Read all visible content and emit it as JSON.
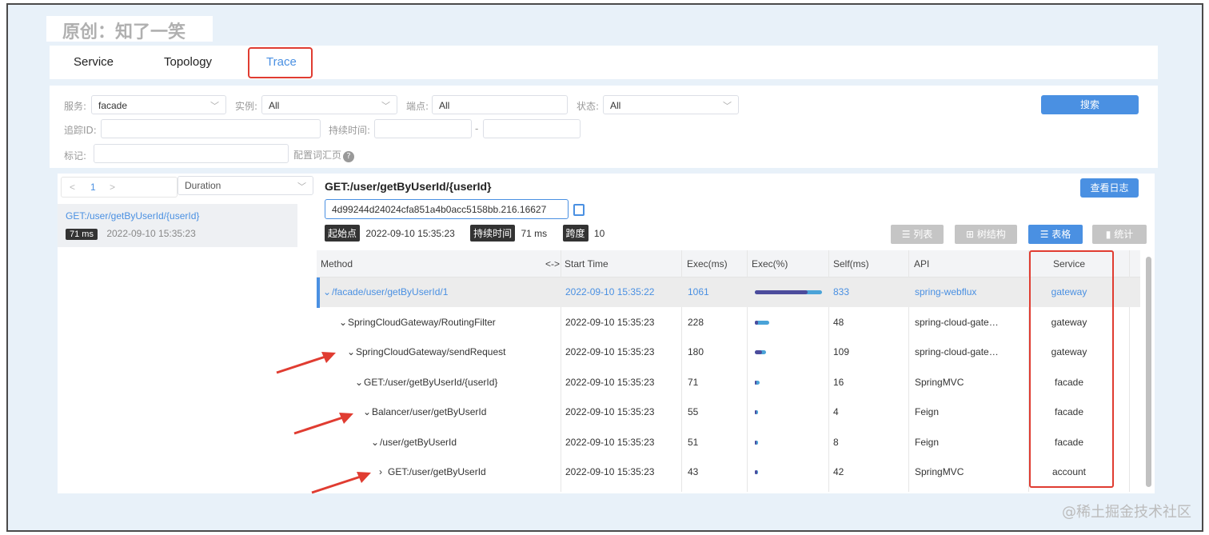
{
  "banner": {
    "text": "原创：知了一笑"
  },
  "tabs": [
    {
      "label": "Service"
    },
    {
      "label": "Topology"
    },
    {
      "label": "Trace"
    }
  ],
  "filters": {
    "service_label": "服务:",
    "service_value": "facade",
    "instance_label": "实例:",
    "instance_value": "All",
    "endpoint_label": "端点:",
    "endpoint_value": "All",
    "status_label": "状态:",
    "status_value": "All",
    "search_label": "搜索",
    "traceid_label": "追踪ID:",
    "traceid_value": "",
    "duration_label": "持续时间:",
    "duration_sep": "-",
    "tag_label": "标记:",
    "tag_value": "",
    "config_label": "配置词汇页"
  },
  "left": {
    "page": "1",
    "prev": "<",
    "next": ">",
    "sort_value": "Duration",
    "trace": {
      "endpoint": "GET:/user/getByUserId/{userId}",
      "duration": "71 ms",
      "time": "2022-09-10 15:35:23"
    }
  },
  "detail": {
    "title": "GET:/user/getByUserId/{userId}",
    "log_button": "查看日志",
    "trace_id": "4d99244d24024cfa851a4b0acc5158bb.216.16627",
    "start_label": "起始点",
    "start_value": "2022-09-10 15:35:23",
    "duration_label": "持续时间",
    "duration_value": "71 ms",
    "span_label": "跨度",
    "span_value": "10",
    "views": [
      "列表",
      "树结构",
      "表格",
      "统计"
    ],
    "active_view": "表格"
  },
  "table": {
    "headers": [
      "Method",
      "<->",
      "Start Time",
      "Exec(ms)",
      "Exec(%)",
      "Self(ms)",
      "API",
      "Service"
    ],
    "rows": [
      {
        "method": "/facade/user/getByUserId/1",
        "toggle": "⌄",
        "start": "2022-09-10 15:35:22",
        "exec": "1061",
        "exec_pct": 1.0,
        "self": "833",
        "self_pct": 0.785,
        "api": "spring-webflux",
        "service": "gateway"
      },
      {
        "method": "SpringCloudGateway/RoutingFilter",
        "toggle": "⌄",
        "start": "2022-09-10 15:35:23",
        "exec": "228",
        "exec_pct": 0.215,
        "self": "48",
        "self_pct": 0.045,
        "api": "spring-cloud-gate…",
        "service": "gateway"
      },
      {
        "method": "SpringCloudGateway/sendRequest",
        "toggle": "⌄",
        "start": "2022-09-10 15:35:23",
        "exec": "180",
        "exec_pct": 0.17,
        "self": "109",
        "self_pct": 0.103,
        "api": "spring-cloud-gate…",
        "service": "gateway"
      },
      {
        "method": "GET:/user/getByUserId/{userId}",
        "toggle": "⌄",
        "start": "2022-09-10 15:35:23",
        "exec": "71",
        "exec_pct": 0.067,
        "self": "16",
        "self_pct": 0.015,
        "api": "SpringMVC",
        "service": "facade"
      },
      {
        "method": "Balancer/user/getByUserId",
        "toggle": "⌄",
        "start": "2022-09-10 15:35:23",
        "exec": "55",
        "exec_pct": 0.052,
        "self": "4",
        "self_pct": 0.004,
        "api": "Feign",
        "service": "facade"
      },
      {
        "method": "/user/getByUserId",
        "toggle": "⌄",
        "start": "2022-09-10 15:35:23",
        "exec": "51",
        "exec_pct": 0.048,
        "self": "8",
        "self_pct": 0.008,
        "api": "Feign",
        "service": "facade"
      },
      {
        "method": "GET:/user/getByUserId",
        "toggle": "›",
        "start": "2022-09-10 15:35:23",
        "exec": "43",
        "exec_pct": 0.041,
        "self": "42",
        "self_pct": 0.04,
        "api": "SpringMVC",
        "service": "account"
      }
    ]
  },
  "watermark": "@稀土掘金技术社区",
  "colors": {
    "accent": "#4a90e2",
    "annotation": "#e03c31",
    "bar_total": "#4aa3d8",
    "bar_self": "#4c4c9c"
  }
}
